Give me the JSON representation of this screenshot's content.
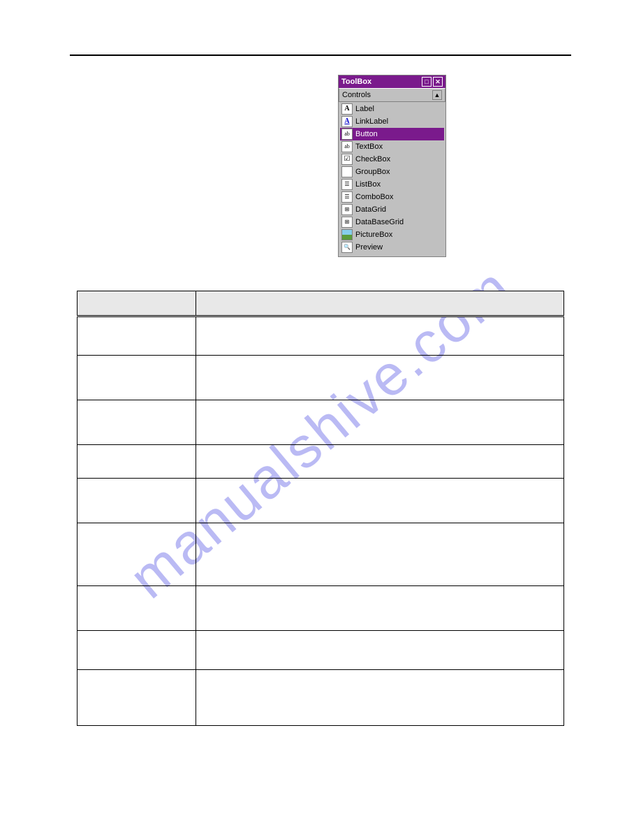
{
  "toolbox": {
    "title": "ToolBox",
    "pin_icon": "📌",
    "close_icon": "✕",
    "section_label": "Controls",
    "arrow_icon": "▲",
    "items": [
      {
        "icon": "A",
        "label": "Label",
        "selected": false,
        "iconClass": "bold"
      },
      {
        "icon": "A",
        "label": "LinkLabel",
        "selected": false,
        "iconClass": "bold blue"
      },
      {
        "icon": "ab",
        "label": "Button",
        "selected": true,
        "iconClass": "small-box"
      },
      {
        "icon": "ab",
        "label": "TextBox",
        "selected": false,
        "iconClass": "small-box"
      },
      {
        "icon": "☑",
        "label": "CheckBox",
        "selected": false,
        "iconClass": ""
      },
      {
        "icon": "",
        "label": "GroupBox",
        "selected": false,
        "iconClass": ""
      },
      {
        "icon": "☰",
        "label": "ListBox",
        "selected": false,
        "iconClass": "small-box"
      },
      {
        "icon": "☰",
        "label": "ComboBox",
        "selected": false,
        "iconClass": "small-box"
      },
      {
        "icon": "⊞",
        "label": "DataGrid",
        "selected": false,
        "iconClass": "small-box"
      },
      {
        "icon": "⊞",
        "label": "DataBaseGrid",
        "selected": false,
        "iconClass": "small-box"
      },
      {
        "icon": "",
        "label": "PictureBox",
        "selected": false,
        "iconClass": "pic"
      },
      {
        "icon": "🔍",
        "label": "Preview",
        "selected": false,
        "iconClass": "small-box"
      }
    ]
  },
  "table": {
    "headers": [
      "",
      ""
    ],
    "rows": [
      {
        "cells": [
          "",
          ""
        ],
        "heightClass": "row-h-56 double-line"
      },
      {
        "cells": [
          "",
          ""
        ],
        "heightClass": "row-h-64"
      },
      {
        "cells": [
          "",
          ""
        ],
        "heightClass": "row-h-64"
      },
      {
        "cells": [
          "",
          ""
        ],
        "heightClass": "row-h-48"
      },
      {
        "cells": [
          "",
          ""
        ],
        "heightClass": "row-h-64"
      },
      {
        "cells": [
          "",
          ""
        ],
        "heightClass": "row-h-90"
      },
      {
        "cells": [
          "",
          ""
        ],
        "heightClass": "row-h-64"
      },
      {
        "cells": [
          "",
          ""
        ],
        "heightClass": "row-h-56"
      },
      {
        "cells": [
          "",
          ""
        ],
        "heightClass": "row-h-80"
      }
    ]
  },
  "watermark": "manualshive.com"
}
